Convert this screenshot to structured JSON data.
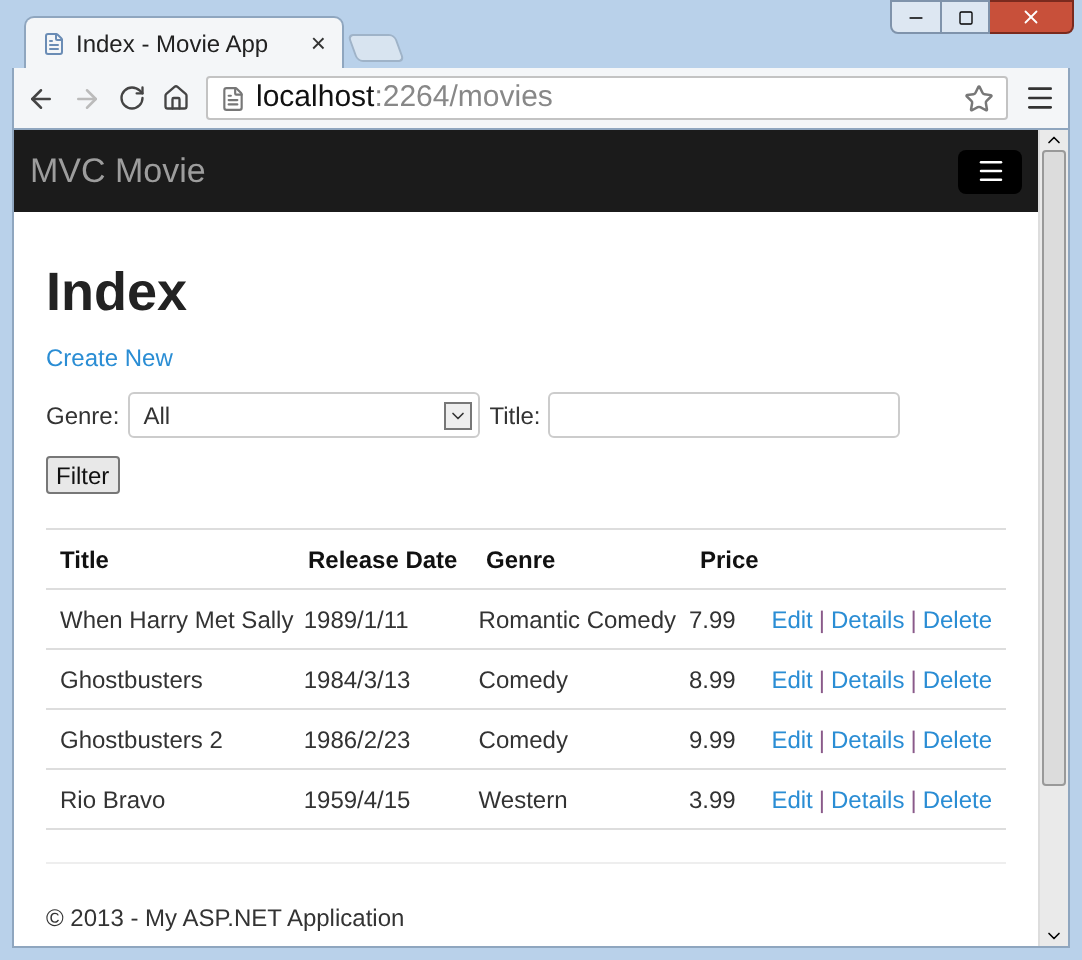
{
  "browser": {
    "tab_title": "Index - Movie App",
    "tab_close": "×",
    "url_host": "localhost",
    "url_path": ":2264/movies"
  },
  "navbar": {
    "brand": "MVC Movie"
  },
  "page": {
    "heading": "Index",
    "create_link": "Create New",
    "filter": {
      "genre_label": "Genre:",
      "genre_value": "All",
      "title_label": "Title:",
      "button": "Filter"
    }
  },
  "table": {
    "columns": [
      "Title",
      "Release Date",
      "Genre",
      "Price"
    ],
    "rows": [
      {
        "cells": [
          "When Harry Met Sally",
          "1989/1/11",
          "Romantic Comedy",
          "7.99"
        ],
        "actions": [
          "Edit",
          "Details",
          "Delete"
        ],
        "separator": "|"
      },
      {
        "cells": [
          "Ghostbusters",
          "1984/3/13",
          "Comedy",
          "8.99"
        ],
        "actions": [
          "Edit",
          "Details",
          "Delete"
        ],
        "separator": "|"
      },
      {
        "cells": [
          "Ghostbusters 2",
          "1986/2/23",
          "Comedy",
          "9.99"
        ],
        "actions": [
          "Edit",
          "Details",
          "Delete"
        ],
        "separator": "|"
      },
      {
        "cells": [
          "Rio Bravo",
          "1959/4/15",
          "Western",
          "3.99"
        ],
        "actions": [
          "Edit",
          "Details",
          "Delete"
        ],
        "separator": "|"
      }
    ]
  },
  "footer": "© 2013 - My ASP.NET Application"
}
